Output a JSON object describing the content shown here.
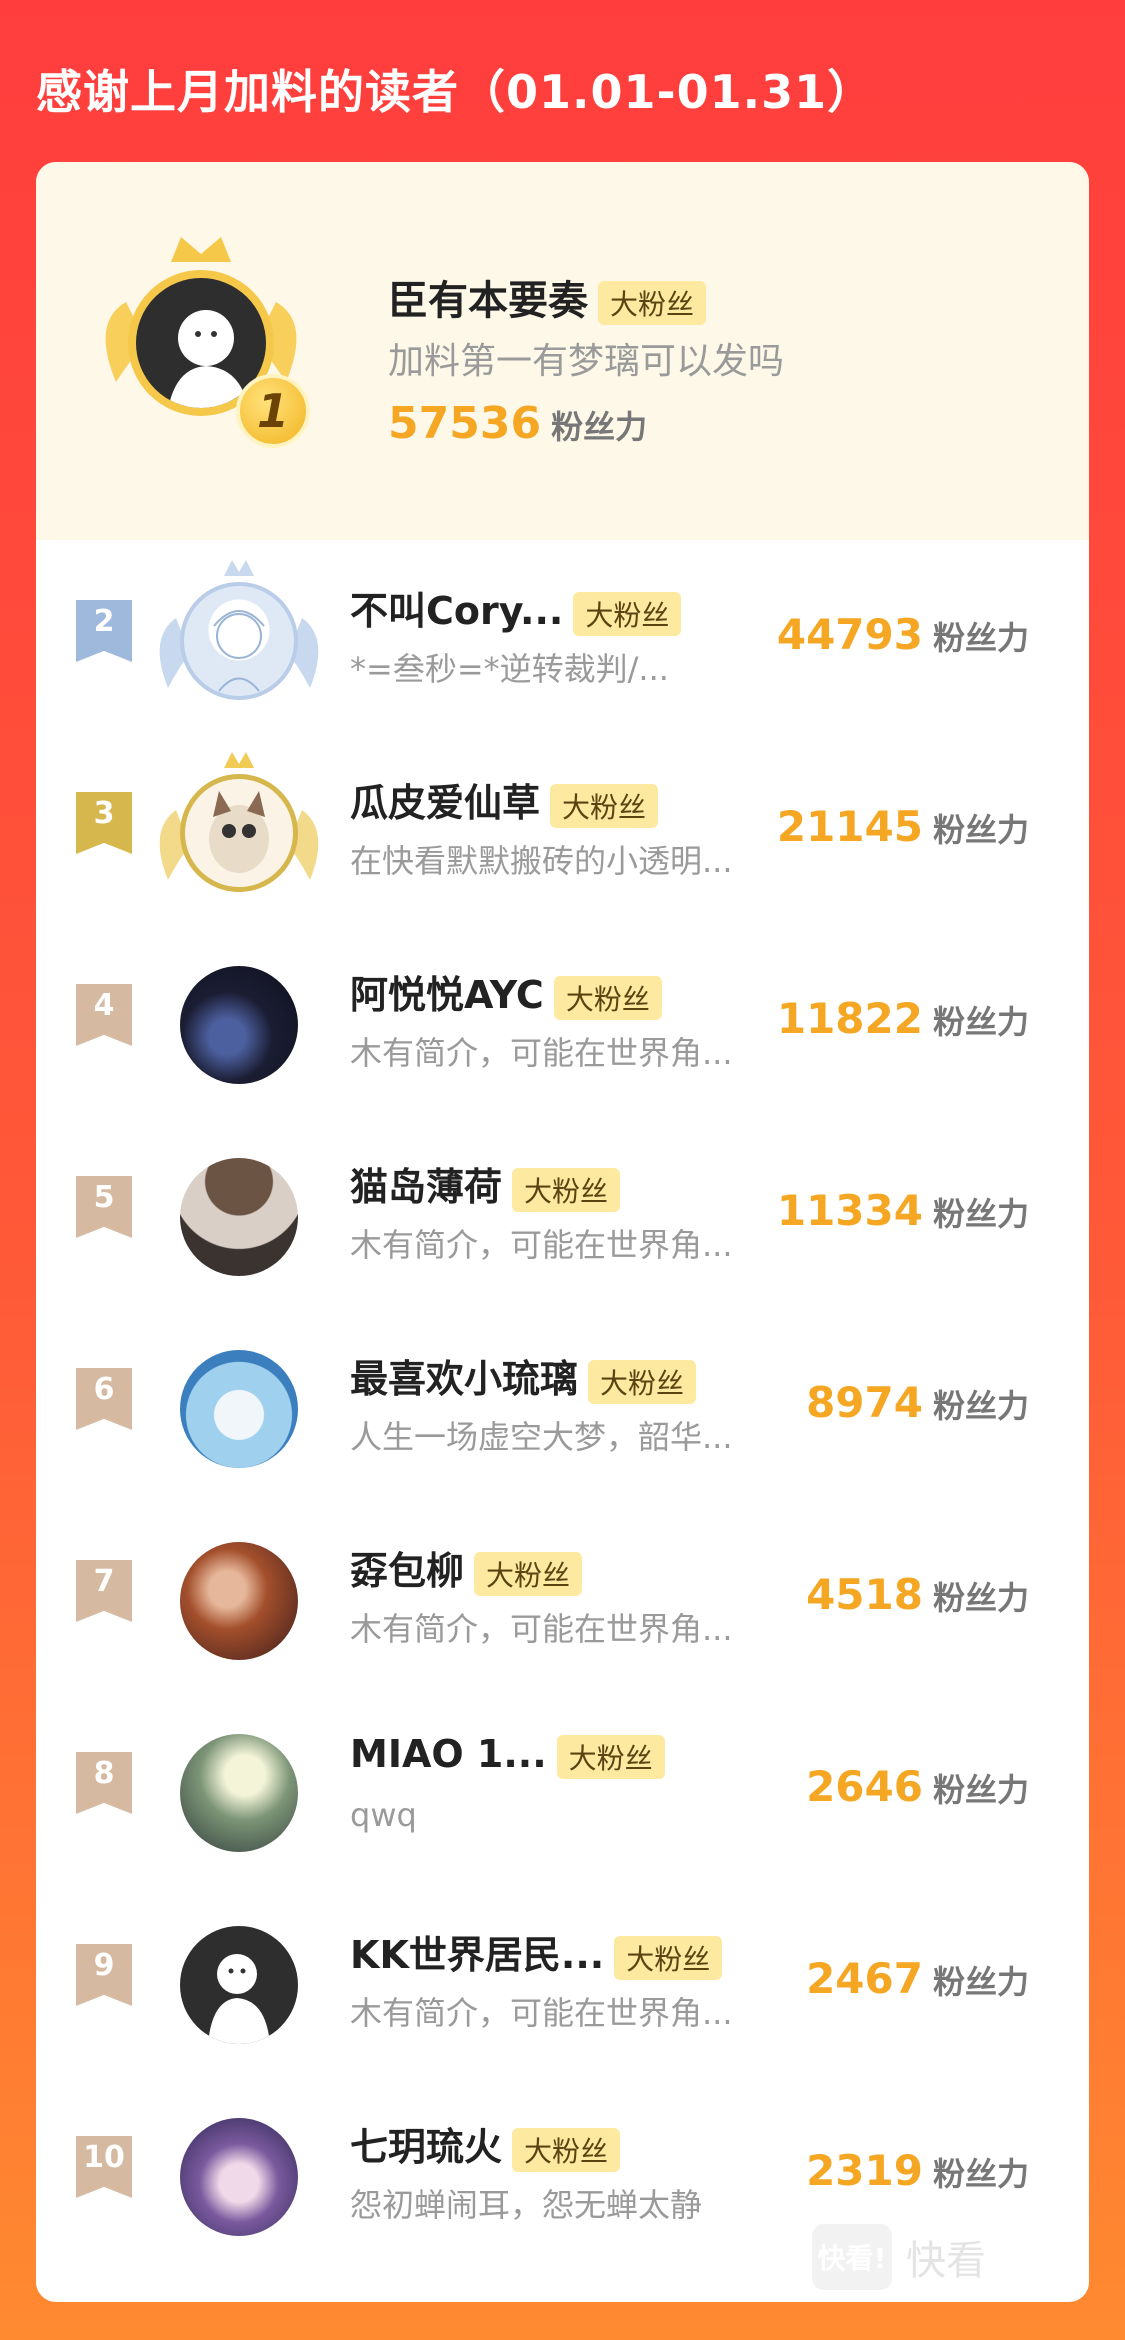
{
  "header": {
    "title": "感谢上月加料的读者（01.01-01.31）"
  },
  "fan_tag": "大粉丝",
  "score_unit": "粉丝力",
  "top1": {
    "rank": "1",
    "name": "臣有本要奏",
    "bio": "加料第一有梦璃可以发吗",
    "score": "57536"
  },
  "rows": [
    {
      "rank": "2",
      "name": "不叫Cory...",
      "bio": "*=叁秒=*逆转裁判/...",
      "score": "44793"
    },
    {
      "rank": "3",
      "name": "瓜皮爱仙草",
      "bio": "在快看默默搬砖的小透明...",
      "score": "21145"
    },
    {
      "rank": "4",
      "name": "阿悦悦AYC",
      "bio": "木有简介，可能在世界角...",
      "score": "11822"
    },
    {
      "rank": "5",
      "name": "猫岛薄荷",
      "bio": "木有简介，可能在世界角...",
      "score": "11334"
    },
    {
      "rank": "6",
      "name": "最喜欢小琉璃",
      "bio": "人生一场虚空大梦，韶华...",
      "score": "8974"
    },
    {
      "rank": "7",
      "name": "孬包柳",
      "bio": "木有简介，可能在世界角...",
      "score": "4518"
    },
    {
      "rank": "8",
      "name": "MIAO  1...",
      "bio": "qwq",
      "score": "2646"
    },
    {
      "rank": "9",
      "name": "KK世界居民...",
      "bio": "木有简介，可能在世界角...",
      "score": "2467"
    },
    {
      "rank": "10",
      "name": "七玥琉火",
      "bio": "怨初蝉闹耳，怨无蝉太静",
      "score": "2319"
    }
  ],
  "watermark": {
    "logo": "快看!",
    "text": "快看"
  },
  "colors": {
    "accent": "#f5a623",
    "tag_bg": "#fdeaa0",
    "bg_top": "#ff3d3d",
    "bg_bottom": "#ff8a30"
  }
}
